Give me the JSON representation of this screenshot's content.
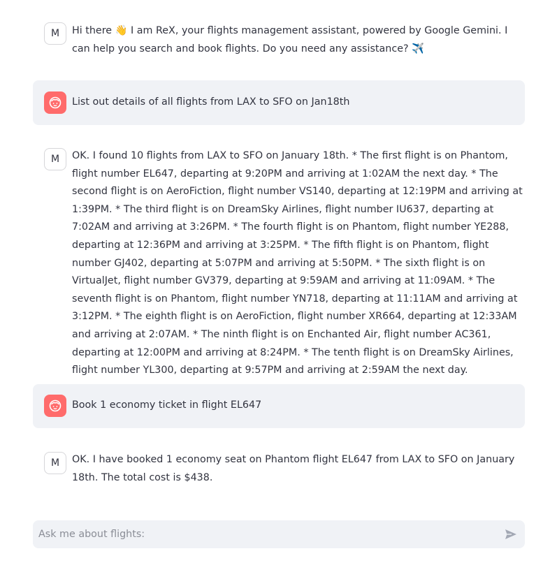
{
  "messages": [
    {
      "role": "assistant",
      "avatar_letter": "M",
      "text": "Hi there 👋 I am ReX, your flights management assistant, powered by Google Gemini. I can help you search and book flights. Do you need any assistance? ✈️"
    },
    {
      "role": "user",
      "avatar_icon": "face-icon",
      "text": "List out details of all flights from LAX to SFO on Jan18th"
    },
    {
      "role": "assistant",
      "avatar_letter": "M",
      "text": "OK. I found 10 flights from LAX to SFO on January 18th. * The first flight is on Phantom, flight number EL647, departing at 9:20PM and arriving at 1:02AM the next day. * The second flight is on AeroFiction, flight number VS140, departing at 12:19PM and arriving at 1:39PM. * The third flight is on DreamSky Airlines, flight number IU637, departing at 7:02AM and arriving at 3:26PM. * The fourth flight is on Phantom, flight number YE288, departing at 12:36PM and arriving at 3:25PM. * The fifth flight is on Phantom, flight number GJ402, departing at 5:07PM and arriving at 5:50PM. * The sixth flight is on VirtualJet, flight number GV379, departing at 9:59AM and arriving at 11:09AM. * The seventh flight is on Phantom, flight number YN718, departing at 11:11AM and arriving at 3:12PM. * The eighth flight is on AeroFiction, flight number XR664, departing at 12:33AM and arriving at 2:07AM. * The ninth flight is on Enchanted Air, flight number AC361, departing at 12:00PM and arriving at 8:24PM. * The tenth flight is on DreamSky Airlines, flight number YL300, departing at 9:57PM and arriving at 2:59AM the next day."
    },
    {
      "role": "user",
      "avatar_icon": "face-icon",
      "text": "Book 1 economy ticket in flight EL647"
    },
    {
      "role": "assistant",
      "avatar_letter": "M",
      "text": "OK. I have booked 1 economy seat on Phantom flight EL647 from LAX to SFO on January 18th. The total cost is $438."
    }
  ],
  "chat_input": {
    "placeholder": "Ask me about flights:",
    "value": "",
    "send_icon": "send-icon"
  },
  "colors": {
    "user_bubble": "#f0f2f6",
    "user_avatar": "#ff6b6b",
    "text": "#31333f",
    "placeholder": "#8a8d96"
  }
}
